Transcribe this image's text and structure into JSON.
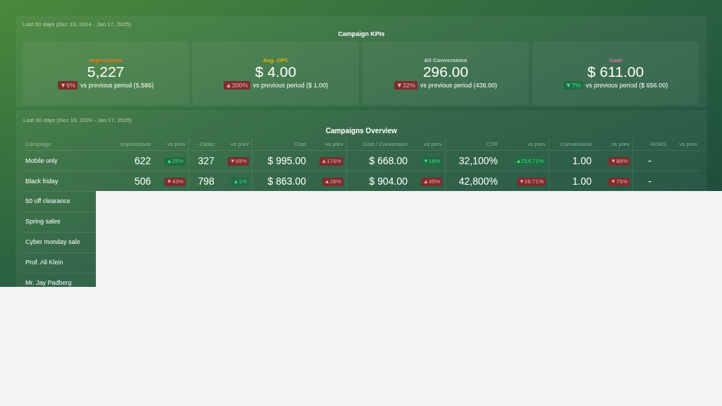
{
  "kpi_panel": {
    "date_range": "Last 30 days (Dec 19, 2024 - Jan 17, 2025)",
    "title": "Campaign KPIs",
    "cards": [
      {
        "label": "Impressions",
        "color": "#f97316",
        "value": "5,227",
        "change": {
          "arrow": "▼",
          "text": "6%",
          "good": false
        },
        "comparison": "vs previous period (5,586)"
      },
      {
        "label": "Avg. CPC",
        "color": "#eab308",
        "value": "$ 4.00",
        "change": {
          "arrow": "▲",
          "text": "300%",
          "good": false
        },
        "comparison": "vs previous period ($ 1.00)"
      },
      {
        "label": "All Conversions",
        "color": "#d1d5db",
        "value": "296.00",
        "change": {
          "arrow": "▼",
          "text": "32%",
          "good": false
        },
        "comparison": "vs previous period (438.00)"
      },
      {
        "label": "Cost",
        "color": "#f472b6",
        "value": "$ 611.00",
        "change": {
          "arrow": "▼",
          "text": "7%",
          "good": true
        },
        "comparison": "vs previous period ($ 656.00)"
      }
    ]
  },
  "table_panel": {
    "date_range": "Last 30 days (Dec 19, 2024 - Jan 17, 2025)",
    "title": "Campaigns Overview",
    "columns": [
      "Campaign",
      "Impressions",
      "vs prev",
      "Clicks",
      "vs prev",
      "Cost",
      "vs prev",
      "Cost / Conversion",
      "vs prev",
      "CTR",
      "vs prev",
      "Conversions",
      "vs prev",
      "ROAS",
      "vs prev"
    ],
    "rows": [
      {
        "campaign": "Mobile only",
        "metrics": [
          {
            "value": "622",
            "change": {
              "arrow": "▲",
              "text": "25%",
              "good": true
            }
          },
          {
            "value": "327",
            "change": {
              "arrow": "▼",
              "text": "65%",
              "good": false
            }
          },
          {
            "value": "$ 995.00",
            "change": {
              "arrow": "▲",
              "text": "176%",
              "good": false
            }
          },
          {
            "value": "$ 668.00",
            "change": {
              "arrow": "▼",
              "text": "18%",
              "good": true
            }
          },
          {
            "value": "32,100%",
            "change": {
              "arrow": "▲",
              "text": "214.71%",
              "good": true
            }
          },
          {
            "value": "1.00",
            "change": {
              "arrow": "▼",
              "text": "88%",
              "good": false
            }
          },
          {
            "value": "-"
          }
        ]
      },
      {
        "campaign": "Black friday",
        "metrics": [
          {
            "value": "506",
            "change": {
              "arrow": "▼",
              "text": "43%",
              "good": false
            }
          },
          {
            "value": "798",
            "change": {
              "arrow": "▲",
              "text": "1%",
              "good": true
            }
          },
          {
            "value": "$ 863.00",
            "change": {
              "arrow": "▲",
              "text": "26%",
              "good": false
            }
          },
          {
            "value": "$ 904.00",
            "change": {
              "arrow": "▲",
              "text": "95%",
              "good": false
            }
          },
          {
            "value": "42,800%",
            "change": {
              "arrow": "▼",
              "text": "26.71%",
              "good": false
            }
          },
          {
            "value": "1.00",
            "change": {
              "arrow": "▼",
              "text": "75%",
              "good": false
            }
          },
          {
            "value": "-"
          }
        ]
      },
      {
        "campaign": "50 off clearance"
      },
      {
        "campaign": "Spring sales"
      },
      {
        "campaign": "Cyber monday sale"
      },
      {
        "campaign": "Prof. Ali Klein"
      },
      {
        "campaign": "Mr. Jay Padberg"
      }
    ]
  }
}
